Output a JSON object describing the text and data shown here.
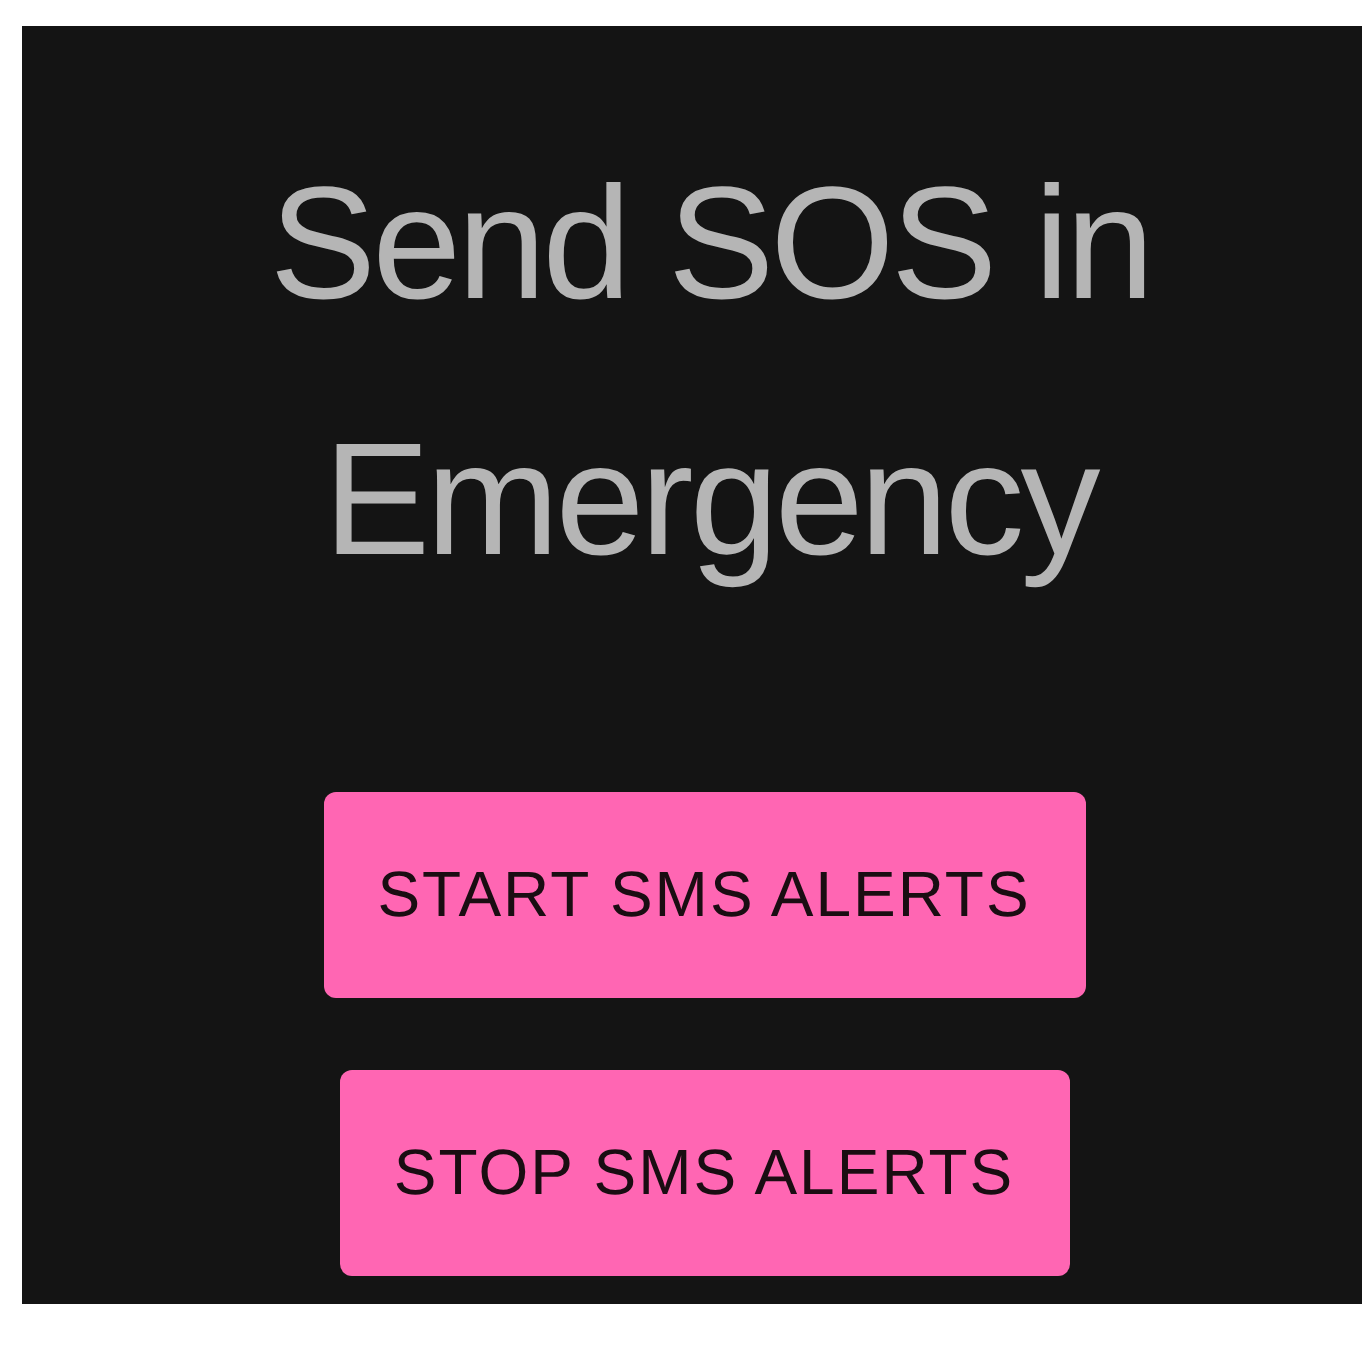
{
  "title": "Send SOS in Emergency",
  "buttons": [
    {
      "label": "START SMS ALERTS"
    },
    {
      "label": "STOP SMS ALERTS"
    }
  ]
}
